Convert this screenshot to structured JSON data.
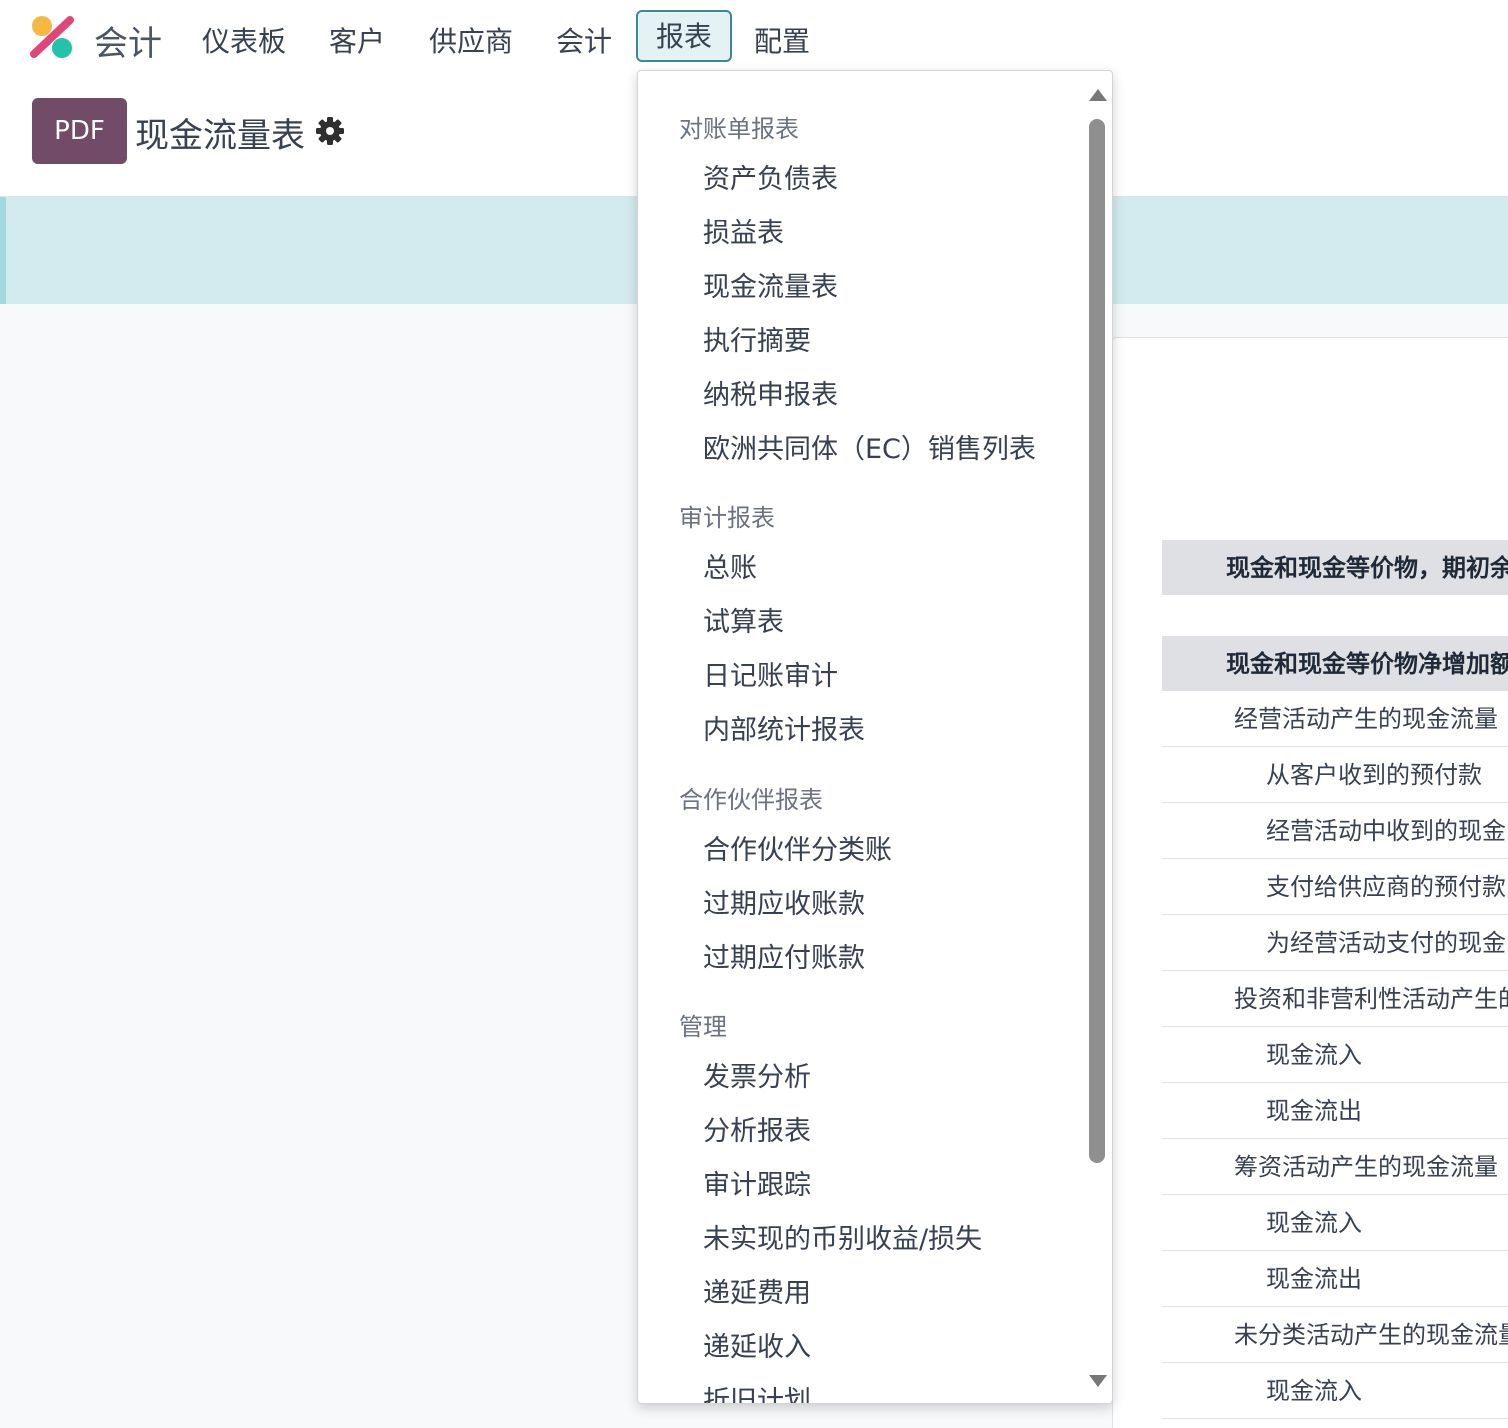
{
  "app": {
    "name": "会计"
  },
  "menu": {
    "dashboard": "仪表板",
    "customers": "客户",
    "vendors": "供应商",
    "accounting": "会计",
    "reporting": "报表",
    "configuration": "配置"
  },
  "control_panel": {
    "pdf_label": "PDF",
    "title": "现金流量表"
  },
  "dropdown": {
    "sections": [
      {
        "header": "对账单报表",
        "items": [
          "资产负债表",
          "损益表",
          "现金流量表",
          "执行摘要",
          "纳税申报表",
          "欧洲共同体（EC）销售列表"
        ]
      },
      {
        "header": "审计报表",
        "items": [
          "总账",
          "试算表",
          "日记账审计",
          "内部统计报表"
        ]
      },
      {
        "header": "合作伙伴报表",
        "items": [
          "合作伙伴分类账",
          "过期应收账款",
          "过期应付账款"
        ]
      },
      {
        "header": "管理",
        "items": [
          "发票分析",
          "分析报表",
          "审计跟踪",
          "未实现的币别收益/损失",
          "递延费用",
          "递延收入",
          "折旧计划"
        ]
      }
    ]
  },
  "report": {
    "rows": [
      {
        "label": "现金和现金等价物，期初余额",
        "kind": "head"
      },
      {
        "label": "",
        "kind": "gap"
      },
      {
        "label": "现金和现金等价物净增加额",
        "kind": "head"
      },
      {
        "label": "经营活动产生的现金流量",
        "kind": "l1"
      },
      {
        "label": "从客户收到的预付款",
        "kind": "l2"
      },
      {
        "label": "经营活动中收到的现金",
        "kind": "l2"
      },
      {
        "label": "支付给供应商的预付款",
        "kind": "l2"
      },
      {
        "label": "为经营活动支付的现金",
        "kind": "l2"
      },
      {
        "label": "投资和非营利性活动产生的现金流量",
        "kind": "l1"
      },
      {
        "label": "现金流入",
        "kind": "l2"
      },
      {
        "label": "现金流出",
        "kind": "l2"
      },
      {
        "label": "筹资活动产生的现金流量",
        "kind": "l1"
      },
      {
        "label": "现金流入",
        "kind": "l2"
      },
      {
        "label": "现金流出",
        "kind": "l2"
      },
      {
        "label": "未分类活动产生的现金流量",
        "kind": "l1"
      },
      {
        "label": "现金流入",
        "kind": "l2"
      }
    ]
  },
  "colors": {
    "brand": "#714b67",
    "accent": "#3c8a94",
    "info_bar": "#d3ebef"
  },
  "icons": {
    "logo": "odoo-accounting-logo",
    "settings": "gear-icon"
  }
}
